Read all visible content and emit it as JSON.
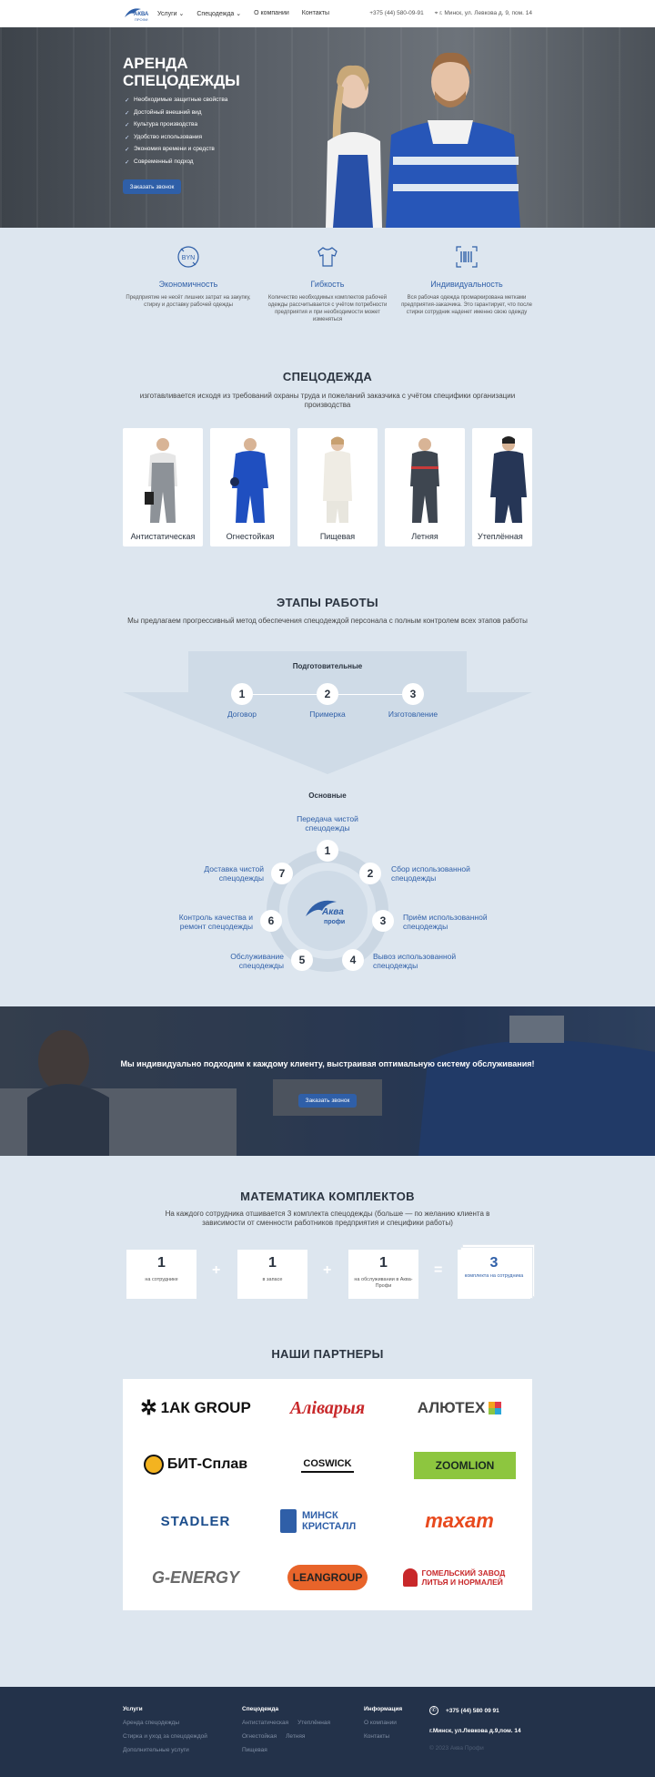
{
  "header": {
    "logo_text": "АКВА",
    "logo_sub": "ПРОФИ",
    "nav": [
      "Услуги",
      "Спецодежда",
      "О компании",
      "Контакты"
    ],
    "phone": "+375 (44) 580-09-91",
    "address": "г. Минск, ул. Левкова д. 9, пом. 14"
  },
  "hero": {
    "title": "АРЕНДА СПЕЦОДЕЖДЫ",
    "bullets": [
      "Необходимые защитные свойства",
      "Достойный внешний вид",
      "Культура производства",
      "Удобство использования",
      "Экономия времени и средств",
      "Современный подход"
    ],
    "button": "Заказать звонок"
  },
  "features": [
    {
      "icon": "byn-coin-icon",
      "title": "Экономичность",
      "text": "Предприятие не несёт лишних затрат на закупку, стирку и доставку рабочей одежды"
    },
    {
      "icon": "tshirt-icon",
      "title": "Гибкость",
      "text": "Количество необходимых комплектов рабочей одежды рассчитывается с учётом потребности предприятия и при необходимости может изменяться"
    },
    {
      "icon": "barcode-icon",
      "title": "Индивидуальность",
      "text": "Вся рабочая одежда промаркирована метками предприятия-заказчика. Это гарантирует, что после стирки сотрудник наденет именно свою одежду"
    }
  ],
  "clothes": {
    "title": "СПЕЦОДЕЖДА",
    "subtitle": "изготавливается исходя из требований охраны труда и пожеланий заказчика с учётом специфики организации производства",
    "items": [
      "Антистатическая",
      "Огнестойкая",
      "Пищевая",
      "Летняя",
      "Утеплённая"
    ]
  },
  "stages": {
    "title": "ЭТАПЫ РАБОТЫ",
    "subtitle": "Мы предлагаем прогрессивный метод обеспечения спецодеждой персонала с полным контролем всех этапов работы",
    "prep_title": "Подготовительные",
    "prep": [
      {
        "num": "1",
        "label": "Договор"
      },
      {
        "num": "2",
        "label": "Примерка"
      },
      {
        "num": "3",
        "label": "Изготовление"
      }
    ],
    "main_title": "Основные",
    "main": [
      {
        "num": "1",
        "label": "Передача чистой спецодежды"
      },
      {
        "num": "2",
        "label": "Сбор использованной спецодежды"
      },
      {
        "num": "3",
        "label": "Приём использованной спецодежды"
      },
      {
        "num": "4",
        "label": "Вывоз использованной спецодежды"
      },
      {
        "num": "5",
        "label": "Обслуживание спецодежды"
      },
      {
        "num": "6",
        "label": "Контроль качества и ремонт спецодежды"
      },
      {
        "num": "7",
        "label": "Доставка чистой спецодежды"
      }
    ],
    "center_logo": "Аква",
    "center_logo_sub": "профи"
  },
  "banner": {
    "text": "Мы индивидуально подходим к каждому клиенту, выстраивая оптимальную систему обслуживания!",
    "button": "Заказать звонок"
  },
  "math": {
    "title": "МАТЕМАТИКА КОМПЛЕКТОВ",
    "subtitle": "На каждого сотрудника отшивается 3 комплекта спецодежды (больше — по желанию клиента в зависимости от сменности работников предприятия и специфики работы)",
    "boxes": [
      {
        "num": "1",
        "text": "на сотруднике"
      },
      {
        "num": "1",
        "text": "в запасе"
      },
      {
        "num": "1",
        "text": "на обслуживании в Аква-Профи"
      },
      {
        "num": "3",
        "text": "комплекта на сотрудника"
      }
    ],
    "ops": [
      "+",
      "+",
      "="
    ]
  },
  "partners": {
    "title": "НАШИ ПАРТНЕРЫ",
    "logos": [
      "1АК GROUP",
      "Алiварыя",
      "АЛЮТЕХ",
      "БИТ-Сплав",
      "COSWICK",
      "ZOOMLION",
      "STADLER",
      "МИНСК КРИСТАЛЛ",
      "тахат",
      "G-ENERGY",
      "LEANGROUP",
      "ГОМЕЛЬСКИЙ ЗАВОД ЛИТЬЯ И НОРМАЛЕЙ"
    ]
  },
  "footer": {
    "col1": {
      "title": "Услуги",
      "items": [
        "Аренда спецодежды",
        "Стирка и уход за спецодеждой",
        "Дополнительные услуги"
      ]
    },
    "col2": {
      "title": "Спецодежда",
      "items": [
        "Антистатическая",
        "Утеплённая",
        "Огнестойкая",
        "Летняя",
        "Пищевая"
      ]
    },
    "col3": {
      "title": "Информация",
      "items": [
        "О компании",
        "Контакты"
      ]
    },
    "phone": "+375 (44) 580 09 91",
    "address": "г.Минск, ул.Левкова д.9,пом. 14",
    "copyright": "© 2023 Аква Профи"
  },
  "colors": {
    "accent": "#2f5fa8",
    "bg": "#dde6ef",
    "footer": "#23324a"
  }
}
